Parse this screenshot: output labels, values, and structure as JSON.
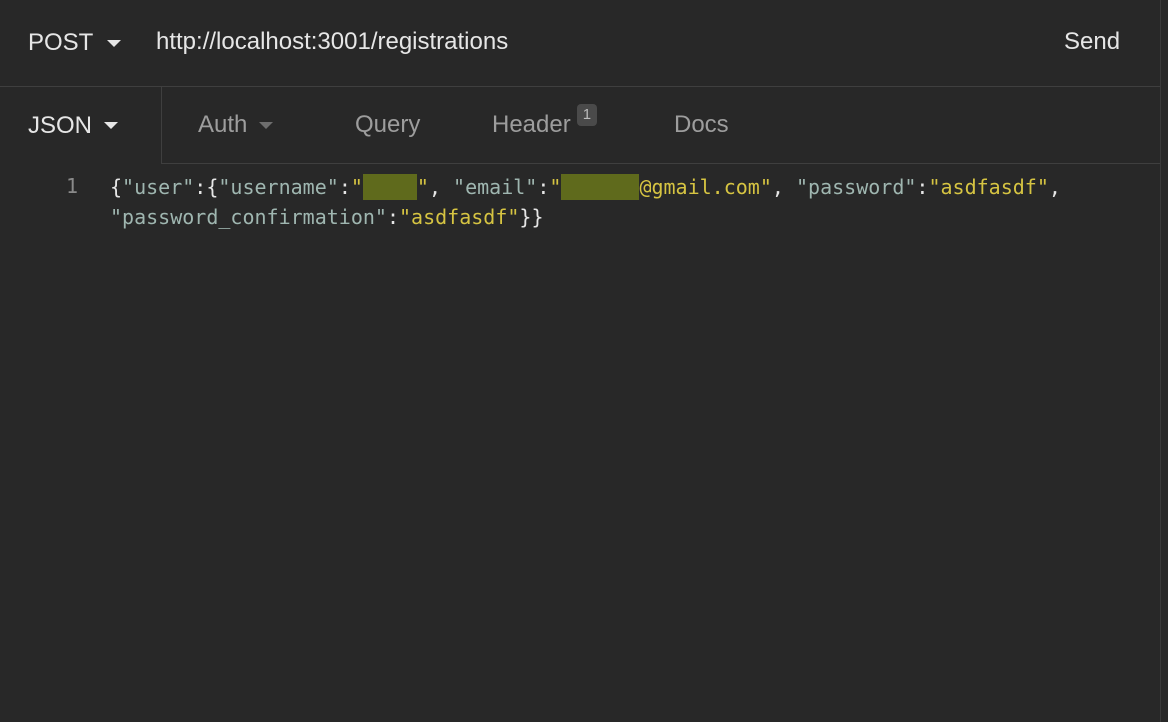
{
  "request": {
    "method": "POST",
    "url": "http://localhost:3001/registrations",
    "send_label": "Send"
  },
  "tabs": {
    "body": "JSON",
    "auth": "Auth",
    "query": "Query",
    "header": "Header",
    "header_count": "1",
    "docs": "Docs"
  },
  "editor": {
    "line_number": "1",
    "code": {
      "open": "{",
      "key_user": "\"user\"",
      "colon1": ":{",
      "key_username": "\"username\"",
      "colon2": ":",
      "quote_open1": "\"",
      "username_redacted": "████",
      "quote_close1": "\"",
      "comma1": ", ",
      "key_email": "\"email\"",
      "colon3": ":",
      "quote_open2": "\"",
      "email_redacted": "██████",
      "email_domain": "@gmail.com\"",
      "comma2": ", ",
      "key_password": "\"password\"",
      "colon4": ":",
      "password_value": "\"asdfasdf\"",
      "comma3": ",",
      "key_password_confirmation": "\"password_confirmation\"",
      "colon5": ":",
      "password_confirmation_value": "\"asdfasdf\"",
      "close": "}}"
    }
  },
  "colors": {
    "background": "#282828",
    "json_key": "#9fb6b0",
    "json_string": "#d6c442",
    "redaction": "#5f6a1c"
  }
}
